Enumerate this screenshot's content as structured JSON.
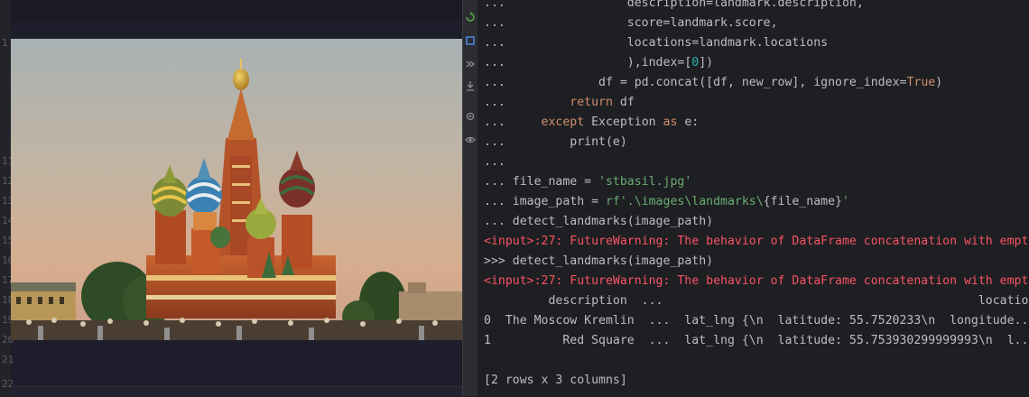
{
  "gutter": {
    "line_numbers": [
      "1",
      "11",
      "12",
      "13",
      "14",
      "15",
      "16",
      "17",
      "18",
      "19",
      "20",
      "21",
      "22"
    ]
  },
  "toolstrip": {
    "tools": [
      "rerun-icon",
      "stop-icon",
      "forward-icon",
      "download-icon",
      "settings-icon",
      "eye-icon"
    ]
  },
  "console": {
    "lines": [
      {
        "prompt": "...",
        "parts": [
          {
            "t": "                 description=landmark.description,",
            "c": ""
          }
        ]
      },
      {
        "prompt": "...",
        "parts": [
          {
            "t": "                 score=landmark.score,",
            "c": ""
          }
        ]
      },
      {
        "prompt": "...",
        "parts": [
          {
            "t": "                 locations=landmark.locations",
            "c": ""
          }
        ]
      },
      {
        "prompt": "...",
        "parts": [
          {
            "t": "                 ),index=[",
            "c": ""
          },
          {
            "t": "0",
            "c": "num"
          },
          {
            "t": "])",
            "c": ""
          }
        ]
      },
      {
        "prompt": "...",
        "parts": [
          {
            "t": "             df = pd.concat([df, new_row], ignore_index=",
            "c": ""
          },
          {
            "t": "True",
            "c": "kw"
          },
          {
            "t": ")",
            "c": ""
          }
        ]
      },
      {
        "prompt": "...",
        "parts": [
          {
            "t": "         ",
            "c": ""
          },
          {
            "t": "return",
            "c": "kw"
          },
          {
            "t": " df",
            "c": ""
          }
        ]
      },
      {
        "prompt": "...",
        "parts": [
          {
            "t": "     ",
            "c": ""
          },
          {
            "t": "except",
            "c": "kw"
          },
          {
            "t": " Exception ",
            "c": ""
          },
          {
            "t": "as",
            "c": "kw"
          },
          {
            "t": " e:",
            "c": ""
          }
        ]
      },
      {
        "prompt": "...",
        "parts": [
          {
            "t": "         print(e)",
            "c": ""
          }
        ]
      },
      {
        "prompt": "...",
        "parts": []
      },
      {
        "prompt": "...",
        "parts": [
          {
            "t": " file_name = ",
            "c": ""
          },
          {
            "t": "'stbasil.jpg'",
            "c": "str"
          }
        ]
      },
      {
        "prompt": "...",
        "parts": [
          {
            "t": " image_path = ",
            "c": ""
          },
          {
            "t": "rf'.\\images\\landmarks\\",
            "c": "str"
          },
          {
            "t": "{file_name}",
            "c": ""
          },
          {
            "t": "'",
            "c": "str"
          }
        ]
      },
      {
        "prompt": "...",
        "parts": [
          {
            "t": " detect_landmarks(image_path)",
            "c": ""
          }
        ]
      },
      {
        "prompt": "",
        "parts": [
          {
            "t": "<input>:27: FutureWarning: The behavior of DataFrame concatenation with empt",
            "c": "err"
          }
        ]
      },
      {
        "prompt": ">>>",
        "parts": [
          {
            "t": " detect_landmarks(image_path)",
            "c": ""
          }
        ]
      },
      {
        "prompt": "",
        "parts": [
          {
            "t": "<input>:27: FutureWarning: The behavior of DataFrame concatenation with empt",
            "c": "err"
          }
        ]
      },
      {
        "prompt": "",
        "parts": [
          {
            "t": "         description  ...                                            location",
            "c": ""
          }
        ]
      },
      {
        "prompt": "",
        "parts": [
          {
            "t": "0  The Moscow Kremlin  ...  lat_lng {\\n  latitude: 55.7520233\\n  longitude..",
            "c": ""
          }
        ]
      },
      {
        "prompt": "",
        "parts": [
          {
            "t": "1          Red Square  ...  lat_lng {\\n  latitude: 55.753930299999993\\n  l..",
            "c": ""
          }
        ]
      },
      {
        "prompt": "",
        "parts": []
      },
      {
        "prompt": "",
        "parts": [
          {
            "t": "[2 rows x 3 columns]",
            "c": ""
          }
        ]
      }
    ]
  },
  "colors": {
    "keyword": "#cf8e6d",
    "string": "#6aab73",
    "number": "#2aacb8",
    "error": "#f75464",
    "text": "#bcbec4",
    "background": "#1e1f22"
  }
}
